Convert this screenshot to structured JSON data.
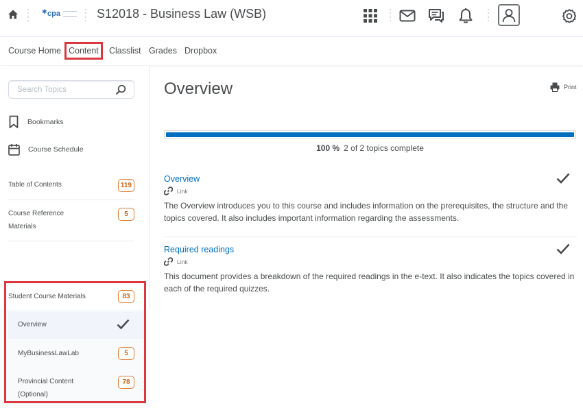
{
  "header": {
    "course_title": "S12018 - Business Law (WSB)",
    "logo_text": "cpa",
    "icons": [
      "home-icon",
      "app-grid-icon",
      "mail-icon",
      "chat-icon",
      "bell-icon",
      "user-avatar-icon",
      "gear-icon"
    ]
  },
  "nav": {
    "items": [
      "Course Home",
      "Content",
      "Classlist",
      "Grades",
      "Dropbox"
    ],
    "active": "Content"
  },
  "sidebar": {
    "search_placeholder": "Search Topics",
    "bookmarks": "Bookmarks",
    "schedule": "Course Schedule",
    "toc": {
      "label": "Table of Contents",
      "count": "119"
    },
    "reference": {
      "label": "Course Reference Materials",
      "count": "5"
    },
    "student": {
      "label": "Student Course Materials",
      "count": "83"
    },
    "sub_items": [
      {
        "label": "Overview",
        "state": "complete"
      },
      {
        "label": "MyBusinessLawLab",
        "count": "5"
      },
      {
        "label": "Provincial Content (Optional)",
        "count": "78"
      }
    ]
  },
  "main": {
    "title": "Overview",
    "print_label": "Print",
    "progress": {
      "percent_value": 100,
      "percent_label": "100 %",
      "summary": "2 of 2 topics complete"
    },
    "topics": [
      {
        "title": "Overview",
        "type": "Link",
        "description": "The Overview introduces you to this course and includes information on the prerequisites, the structure and the topics covered. It also includes important information regarding the assessments.",
        "complete": true
      },
      {
        "title": "Required readings",
        "type": "Link",
        "description": "This document provides a breakdown of the required readings in the e-text. It also indicates the topics covered in each of the required quizzes.",
        "complete": true
      }
    ]
  },
  "colors": {
    "accent": "#006fbf",
    "badge": "#e07a2e",
    "highlight": "#d9383f"
  }
}
